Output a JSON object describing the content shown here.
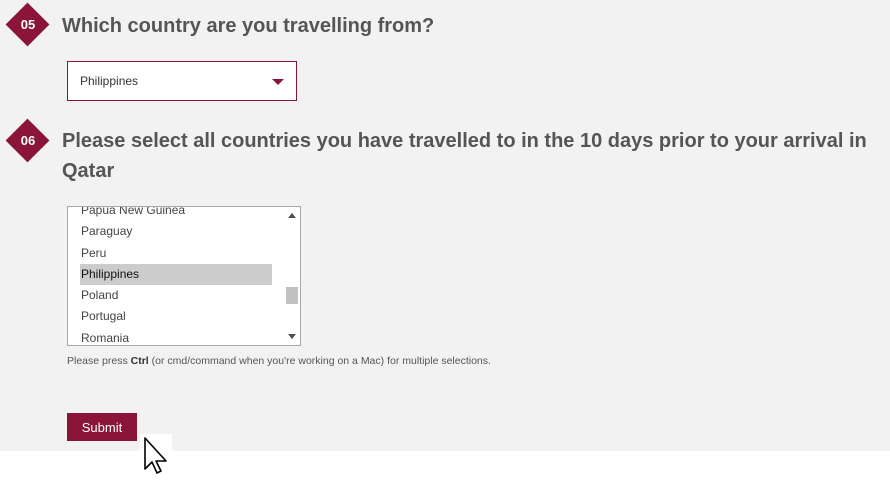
{
  "questions": [
    {
      "number": "05",
      "title": "Which country are you travelling from?"
    },
    {
      "number": "06",
      "title": "Please select all countries you have travelled to in the 10 days prior to your arrival in Qatar"
    }
  ],
  "origin_select": {
    "value": "Philippines"
  },
  "countries_list": {
    "items": [
      "Papua New Guinea",
      "Paraguay",
      "Peru",
      "Philippines",
      "Poland",
      "Portugal",
      "Romania"
    ],
    "selected": "Philippines"
  },
  "hint": {
    "prefix": "Please press ",
    "key": "Ctrl",
    "suffix": " (or cmd/command when you're working on a Mac) for multiple selections."
  },
  "submit": {
    "label": "Submit"
  },
  "colors": {
    "accent": "#8a1538",
    "panel": "#f2f2f2",
    "selected_row": "#cccccc"
  }
}
